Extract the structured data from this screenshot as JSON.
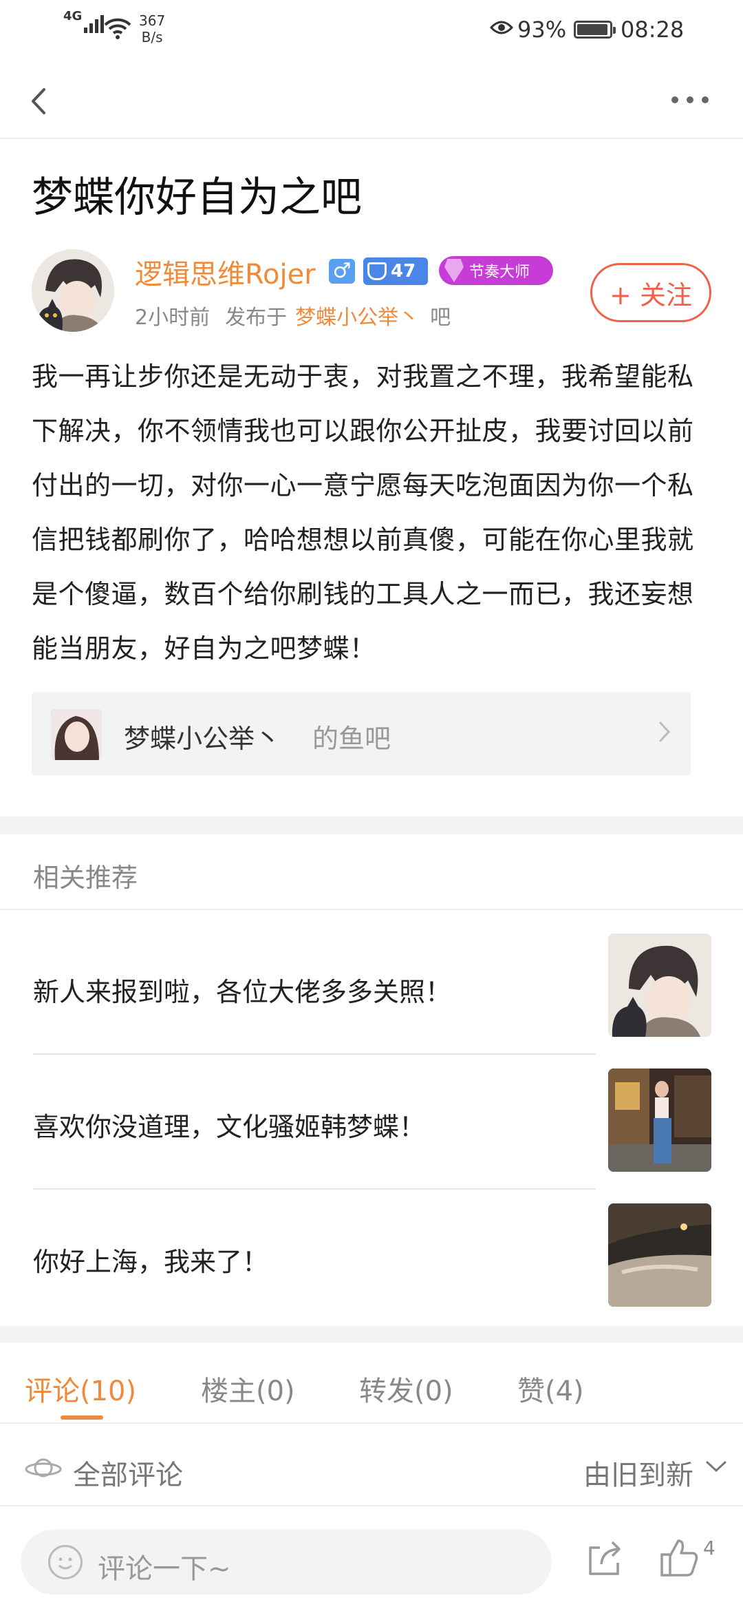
{
  "status_bar": {
    "network": "4G",
    "speed_value": "367",
    "speed_unit": "B/s",
    "battery": "93%",
    "time": "08:28"
  },
  "nav": {
    "back_icon": "chevron-left-icon",
    "more_icon": "more-dots-icon"
  },
  "post": {
    "title": "梦蝶你好自为之吧",
    "author": {
      "name": "逻辑思维Rojer",
      "gender_symbol": "♂",
      "level": "47",
      "badge_label": "节奏大师"
    },
    "meta": {
      "time": "2小时前",
      "published_in": "发布于",
      "forum": "梦蝶小公举丶",
      "forum_suffix": "吧"
    },
    "follow_label": "+ 关注",
    "body": "我一再让步你还是无动于衷，对我置之不理，我希望能私下解决，你不领情我也可以跟你公开扯皮，我要讨回以前付出的一切，对你一心一意宁愿每天吃泡面因为你一个私信把钱都刷你了，哈哈想想以前真傻，可能在你心里我就是个傻逼，数百个给你刷钱的工具人之一而已，我还妄想能当朋友，好自为之吧梦蝶！"
  },
  "forum_card": {
    "name": "梦蝶小公举丶",
    "suffix": "的鱼吧"
  },
  "related": {
    "title": "相关推荐",
    "items": [
      {
        "text": "新人来报到啦，各位大佬多多关照！"
      },
      {
        "text": "喜欢你没道理，文化骚姬韩梦蝶！"
      },
      {
        "text": "你好上海，我来了！"
      }
    ]
  },
  "tabs": [
    {
      "label": "评论(10)",
      "active": true
    },
    {
      "label": "楼主(0)",
      "active": false
    },
    {
      "label": "转发(0)",
      "active": false
    },
    {
      "label": "赞(4)",
      "active": false
    }
  ],
  "comments": {
    "all_label": "全部评论",
    "sort_label": "由旧到新"
  },
  "bottom_bar": {
    "placeholder": "评论一下~",
    "like_count": "4"
  },
  "colors": {
    "accent": "#f08a3a",
    "follow": "#f0604a",
    "rhythm_badge": "#c73bd6",
    "level_badge": "#4a86e8"
  }
}
